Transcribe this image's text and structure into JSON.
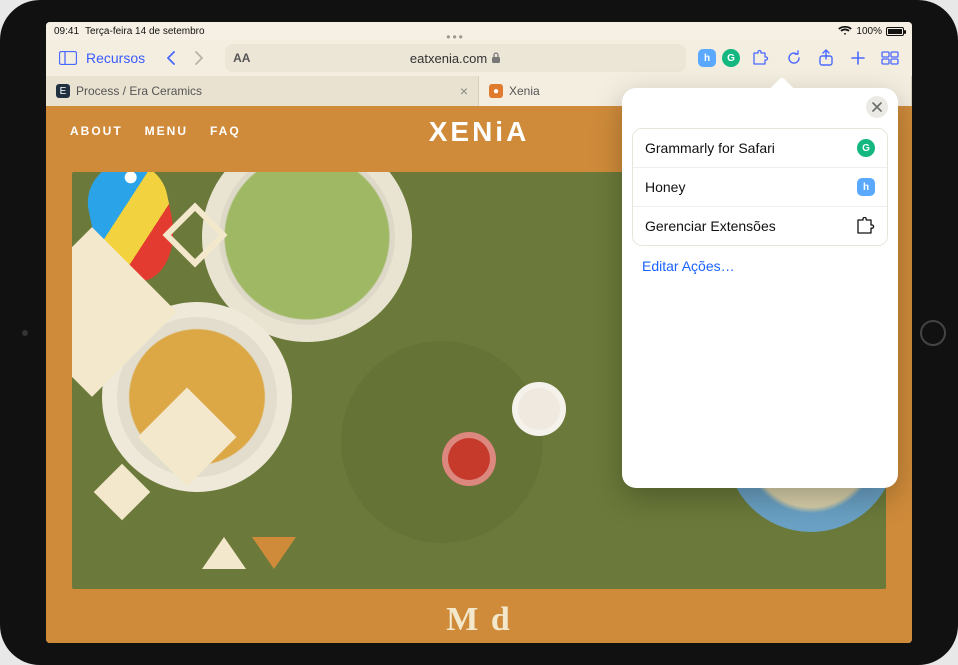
{
  "statusbar": {
    "time": "09:41",
    "date": "Terça-feira 14 de setembro",
    "battery_pct": "100%"
  },
  "toolbar": {
    "bookmarks_label": "Recursos",
    "aA_label": "AA",
    "url_host": "eatxenia.com"
  },
  "tabs": [
    {
      "title": "Process / Era Ceramics",
      "active": false,
      "favicon_bg": "#203040",
      "favicon_text": "E"
    },
    {
      "title": "Xenia",
      "active": true,
      "favicon_bg": "#e07a2c",
      "favicon_text": "●"
    }
  ],
  "page": {
    "nav": [
      "ABOUT",
      "MENU",
      "FAQ"
    ],
    "logo": "XENiA",
    "hero_headline_partial": "M   d"
  },
  "popover": {
    "items": [
      {
        "label": "Grammarly for Safari",
        "icon": "grammarly"
      },
      {
        "label": "Honey",
        "icon": "honey"
      },
      {
        "label": "Gerenciar Extensões",
        "icon": "puzzle"
      }
    ],
    "edit_link": "Editar Ações…"
  }
}
